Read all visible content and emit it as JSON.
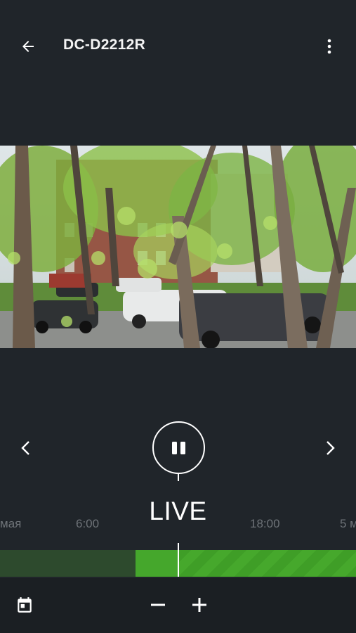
{
  "header": {
    "title": "DC-D2212R",
    "back_icon": "arrow-left-icon",
    "menu_icon": "more-vertical-icon"
  },
  "player": {
    "status": "LIVE",
    "pause_icon": "pause-icon",
    "prev_icon": "chevron-left-icon",
    "next_icon": "chevron-right-icon"
  },
  "timeline": {
    "labels": [
      "мая",
      "6:00",
      "18:00",
      "5 м"
    ],
    "recorded_color": "#46a82c",
    "empty_color": "#2d4a2d"
  },
  "bottom": {
    "calendar_icon": "calendar-icon",
    "zoom_out_label": "−",
    "zoom_in_label": "+"
  },
  "colors": {
    "background": "#20252a",
    "bottom_bar": "#1b1f23",
    "timeline_label": "#6e7378"
  }
}
